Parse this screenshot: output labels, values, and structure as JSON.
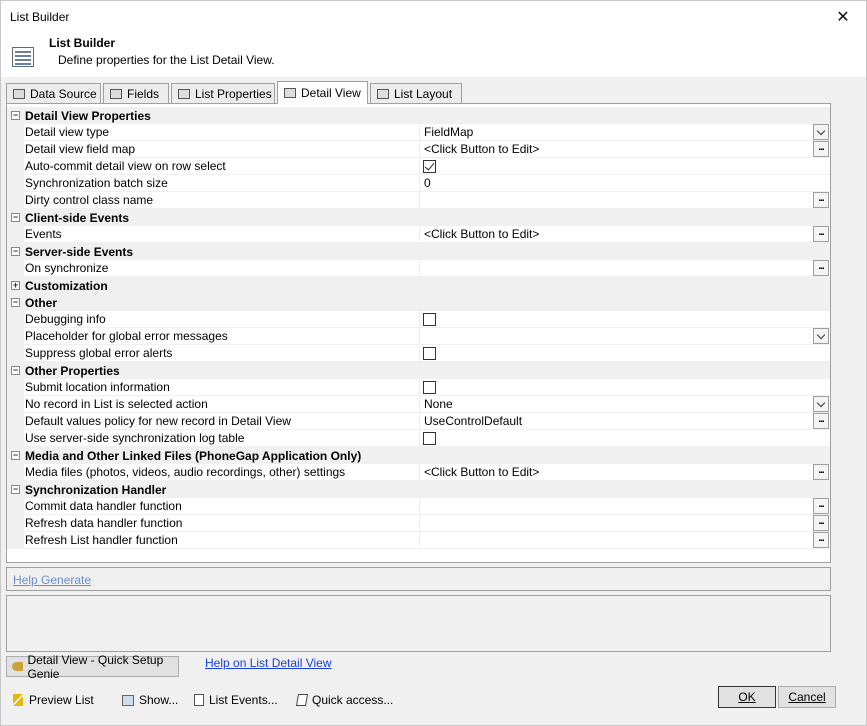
{
  "window": {
    "title": "List Builder",
    "close_glyph": "✕"
  },
  "header": {
    "title": "List Builder",
    "subtitle": "Define properties for the List Detail View."
  },
  "tabs": [
    {
      "label": "Data Source",
      "icon": "database-icon",
      "active": false
    },
    {
      "label": "Fields",
      "icon": "fields-icon",
      "active": false
    },
    {
      "label": "List Properties",
      "icon": "list-properties-icon",
      "active": false
    },
    {
      "label": "Detail View",
      "icon": "detail-view-icon",
      "active": true
    },
    {
      "label": "List Layout",
      "icon": "list-layout-icon",
      "active": false
    }
  ],
  "grid": {
    "categories": [
      {
        "label": "Detail View Properties",
        "expanded": true,
        "expander": "−",
        "rows": [
          {
            "name": "Detail view type",
            "value": "FieldMap",
            "editor": "dropdown"
          },
          {
            "name": "Detail view field map",
            "value": "<Click Button to Edit>",
            "editor": "ellipsis"
          },
          {
            "name": "Auto-commit detail view on row select",
            "checked": true,
            "editor": "checkbox"
          },
          {
            "name": "Synchronization batch size",
            "value": "0",
            "editor": "text"
          },
          {
            "name": "Dirty control class name",
            "value": "",
            "editor": "ellipsis"
          }
        ]
      },
      {
        "label": "Client-side Events",
        "expanded": true,
        "expander": "−",
        "rows": [
          {
            "name": "Events",
            "value": "<Click Button to Edit>",
            "editor": "ellipsis"
          }
        ]
      },
      {
        "label": "Server-side Events",
        "expanded": true,
        "expander": "−",
        "rows": [
          {
            "name": "On synchronize",
            "value": "",
            "editor": "ellipsis"
          }
        ]
      },
      {
        "label": "Customization",
        "expanded": false,
        "expander": "+",
        "rows": []
      },
      {
        "label": "Other",
        "expanded": true,
        "expander": "−",
        "rows": [
          {
            "name": "Debugging info",
            "checked": false,
            "editor": "checkbox"
          },
          {
            "name": "Placeholder for global error messages",
            "value": "",
            "editor": "dropdown"
          },
          {
            "name": "Suppress global error alerts",
            "checked": false,
            "editor": "checkbox"
          }
        ]
      },
      {
        "label": "Other Properties",
        "expanded": true,
        "expander": "−",
        "rows": [
          {
            "name": "Submit location information",
            "checked": false,
            "editor": "checkbox"
          },
          {
            "name": "No record in List is selected action",
            "value": "None",
            "editor": "dropdown"
          },
          {
            "name": "Default values policy for new record in Detail View",
            "value": "UseControlDefault",
            "editor": "ellipsis"
          },
          {
            "name": "Use server-side synchronization log table",
            "checked": false,
            "editor": "checkbox"
          }
        ]
      },
      {
        "label": "Media and Other Linked Files  (PhoneGap Application Only)",
        "expanded": true,
        "expander": "−",
        "rows": [
          {
            "name": "Media files (photos, videos, audio recordings, other) settings",
            "value": "<Click Button to Edit>",
            "editor": "ellipsis"
          }
        ]
      },
      {
        "label": "Synchronization Handler",
        "expanded": true,
        "expander": "−",
        "rows": [
          {
            "name": "Commit data handler function",
            "value": "",
            "editor": "ellipsis"
          },
          {
            "name": "Refresh data handler function",
            "value": "",
            "editor": "ellipsis"
          },
          {
            "name": "Refresh List handler function",
            "value": "",
            "editor": "ellipsis"
          }
        ]
      }
    ]
  },
  "help_generate": "Help Generate",
  "genie_button": "Detail View - Quick Setup Genie",
  "help_link": "Help on List Detail View",
  "bottom_actions": [
    {
      "label": "Preview List",
      "icon": "lightning-icon"
    },
    {
      "label": "Show...",
      "icon": "image-icon"
    },
    {
      "label": "List Events...",
      "icon": "list-events-icon"
    },
    {
      "label": "Quick access...",
      "icon": "edit-icon"
    }
  ],
  "ok_label": "OK",
  "cancel_label": "Cancel"
}
